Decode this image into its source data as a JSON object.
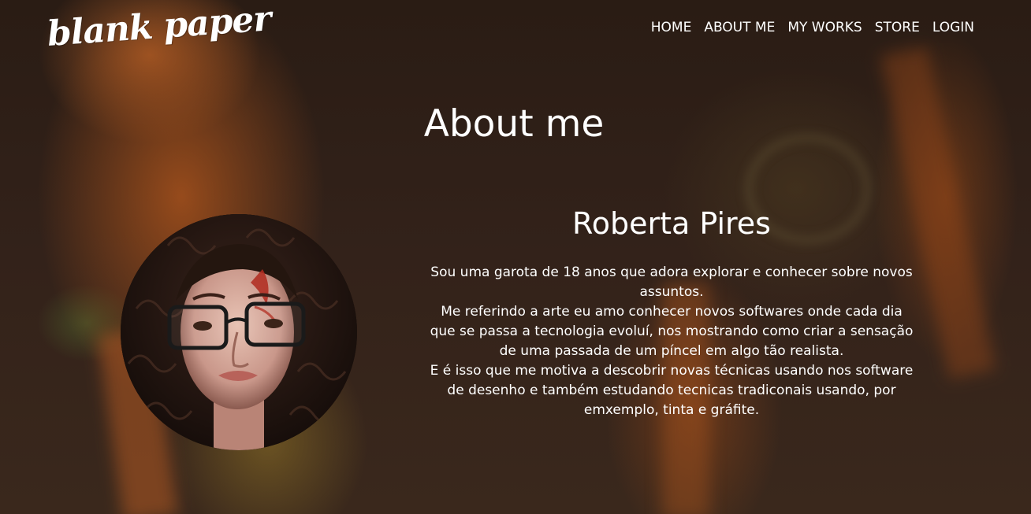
{
  "brand": {
    "logo_text": "blank paper"
  },
  "nav": {
    "items": [
      {
        "id": "home",
        "label": "HOME"
      },
      {
        "id": "about-me",
        "label": "ABOUT ME"
      },
      {
        "id": "my-works",
        "label": "MY WORKS"
      },
      {
        "id": "store",
        "label": "STORE"
      },
      {
        "id": "login",
        "label": "LOGIN"
      }
    ]
  },
  "main": {
    "title": "About me",
    "profile": {
      "name": "Roberta Pires",
      "bio": [
        "Sou uma garota de 18 anos que adora explorar e conhecer sobre novos assuntos.",
        "Me referindo a arte eu amo conhecer novos softwares onde cada dia que se passa a tecnologia evoluí, nos mostrando como criar a sensação de uma passada de um píncel em algo tão realista.",
        "E é isso que me motiva a descobrir novas técnicas usando nos software de desenho e também estudando tecnicas tradiconais usando, por emxemplo, tinta e gráfite."
      ]
    }
  },
  "colors": {
    "text": "#ffffff",
    "background": "#2c1d14",
    "accent_orange": "#a8521c"
  }
}
